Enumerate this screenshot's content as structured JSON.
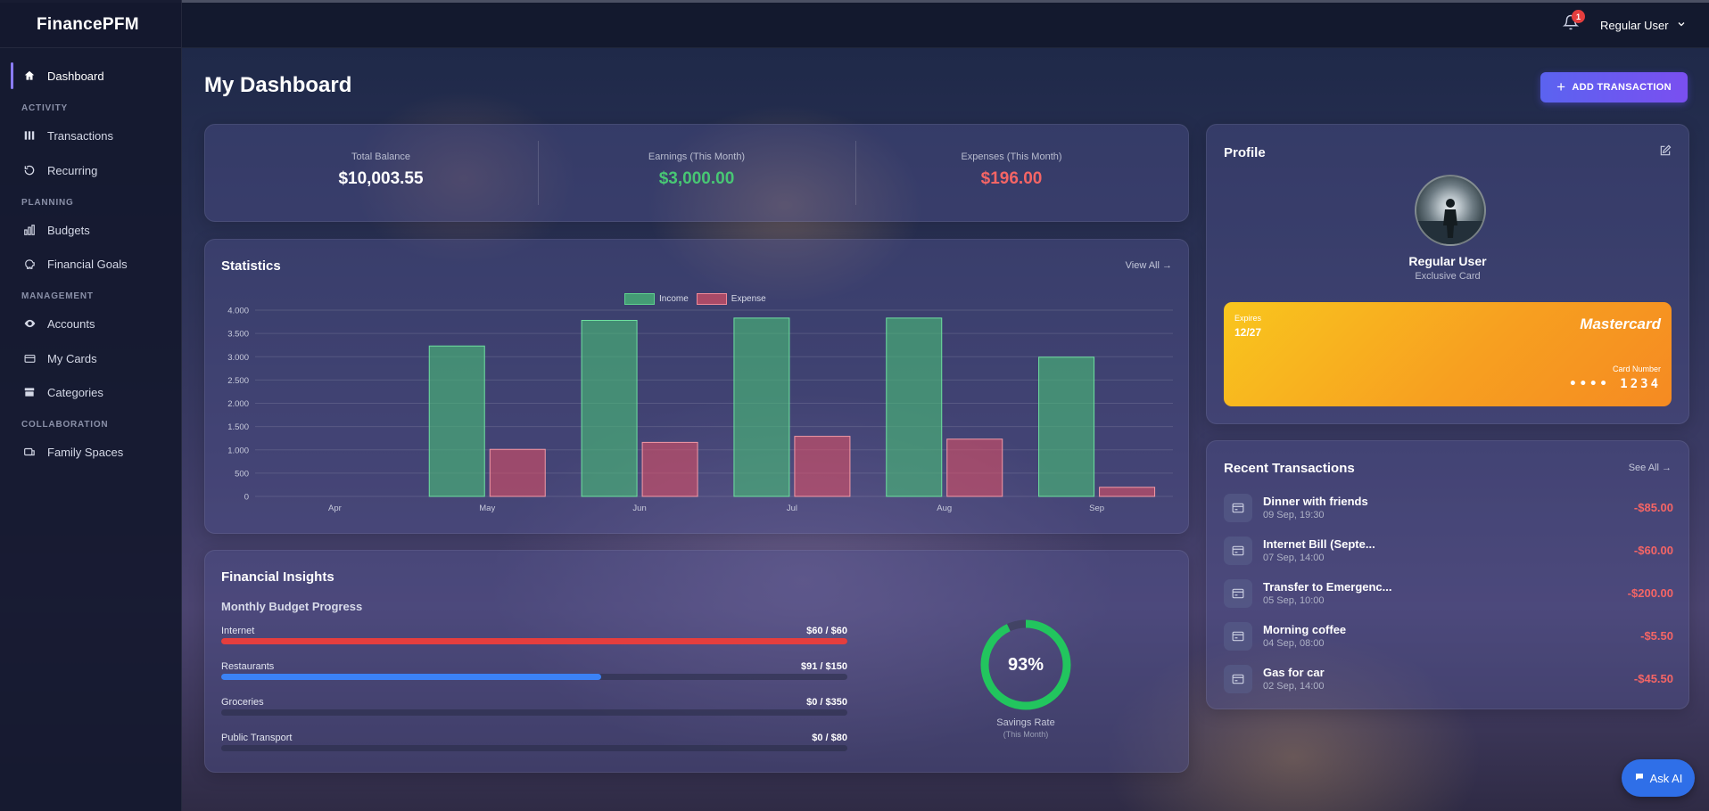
{
  "app": {
    "brand": "FinancePFM"
  },
  "topbar": {
    "notif_count": "1",
    "user_name": "Regular User"
  },
  "sidebar": {
    "items": [
      {
        "label": "Dashboard"
      },
      {
        "section": "ACTIVITY"
      },
      {
        "label": "Transactions"
      },
      {
        "label": "Recurring"
      },
      {
        "section": "PLANNING"
      },
      {
        "label": "Budgets"
      },
      {
        "label": "Financial Goals"
      },
      {
        "section": "MANAGEMENT"
      },
      {
        "label": "Accounts"
      },
      {
        "label": "My Cards"
      },
      {
        "label": "Categories"
      },
      {
        "section": "COLLABORATION"
      },
      {
        "label": "Family Spaces"
      }
    ]
  },
  "page": {
    "title": "My Dashboard",
    "add_button": "ADD TRANSACTION"
  },
  "summary": {
    "balance_label": "Total Balance",
    "balance_value": "$10,003.55",
    "earnings_label": "Earnings (This Month)",
    "earnings_value": "$3,000.00",
    "expenses_label": "Expenses (This Month)",
    "expenses_value": "$196.00",
    "colors": {
      "earnings": "#48c774",
      "expenses": "#f56565"
    }
  },
  "statistics": {
    "title": "Statistics",
    "view_all": "View All →"
  },
  "chart_data": {
    "type": "bar",
    "categories": [
      "Apr",
      "May",
      "Jun",
      "Jul",
      "Aug",
      "Sep"
    ],
    "series": [
      {
        "name": "Income",
        "values": [
          0,
          3230,
          3780,
          3830,
          3830,
          2990
        ],
        "color": "#48bb78"
      },
      {
        "name": "Expense",
        "values": [
          0,
          1010,
          1160,
          1290,
          1230,
          196
        ],
        "color": "#e55064"
      }
    ],
    "yticks": [
      "4.000",
      "3.500",
      "3.000",
      "2.500",
      "2.000",
      "1.500",
      "1.000",
      "500",
      "0"
    ],
    "ylim": [
      0,
      4000
    ],
    "legend": "top-center",
    "grid": true
  },
  "insights": {
    "title": "Financial Insights",
    "subtitle": "Monthly Budget Progress",
    "budgets": [
      {
        "name": "Internet",
        "amount": "$60 / $60",
        "progress": 1.0,
        "color": "#e53e3e"
      },
      {
        "name": "Restaurants",
        "amount": "$91 / $150",
        "progress": 0.6067,
        "color": "#3b82f6"
      },
      {
        "name": "Groceries",
        "amount": "$0 / $350",
        "progress": 0,
        "color": "#3b82f6"
      },
      {
        "name": "Public Transport",
        "amount": "$0 / $80",
        "progress": 0,
        "color": "#3b82f6"
      }
    ],
    "savings": {
      "value": "93%",
      "fraction": 0.93,
      "label": "Savings Rate",
      "sub": "(This Month)",
      "color": "#22c55e"
    }
  },
  "profile": {
    "title": "Profile",
    "name": "Regular User",
    "card_tier": "Exclusive Card",
    "card": {
      "expires_label": "Expires",
      "expires": "12/27",
      "brand": "Mastercard",
      "number_label": "Card Number",
      "number": "•••• 1234"
    }
  },
  "recent": {
    "title": "Recent Transactions",
    "see_all": "See All →",
    "items": [
      {
        "name": "Dinner with friends",
        "date": "09 Sep, 19:30",
        "amount": "-$85.00"
      },
      {
        "name": "Internet Bill (Septe...",
        "date": "07 Sep, 14:00",
        "amount": "-$60.00"
      },
      {
        "name": "Transfer to Emergenc...",
        "date": "05 Sep, 10:00",
        "amount": "-$200.00"
      },
      {
        "name": "Morning coffee",
        "date": "04 Sep, 08:00",
        "amount": "-$5.50"
      },
      {
        "name": "Gas for car",
        "date": "02 Sep, 14:00",
        "amount": "-$45.50"
      }
    ]
  },
  "assistant": {
    "label": "Ask AI"
  }
}
